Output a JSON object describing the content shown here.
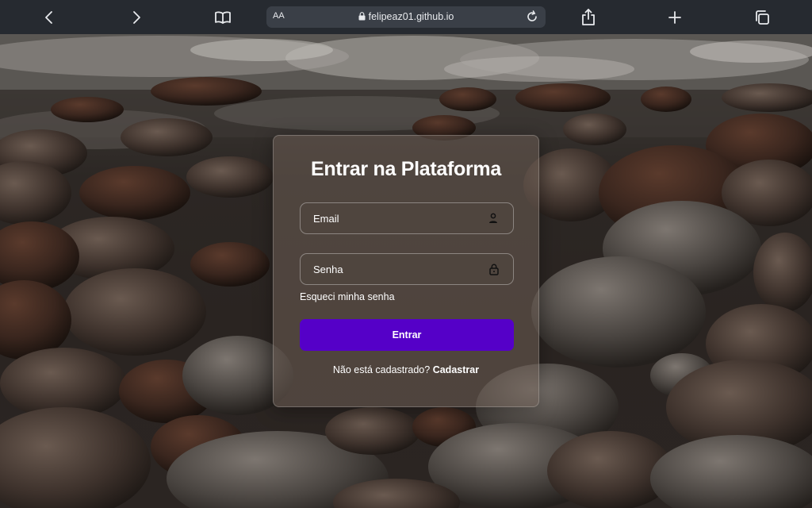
{
  "browser": {
    "text_size_label": "AA",
    "url": "felipeaz01.github.io",
    "icons": [
      "back-icon",
      "forward-icon",
      "book-icon",
      "lock-icon",
      "reload-icon",
      "share-icon",
      "plus-icon",
      "tabs-icon"
    ]
  },
  "login": {
    "title": "Entrar na Plataforma",
    "email_placeholder": "Email",
    "password_placeholder": "Senha",
    "forgot_label": "Esqueci minha senha",
    "submit_label": "Entrar",
    "signup_prompt": "Não está cadastrado?",
    "signup_link": "Cadastrar"
  },
  "colors": {
    "accent": "#5500c8",
    "toolbar": "#262a30"
  }
}
